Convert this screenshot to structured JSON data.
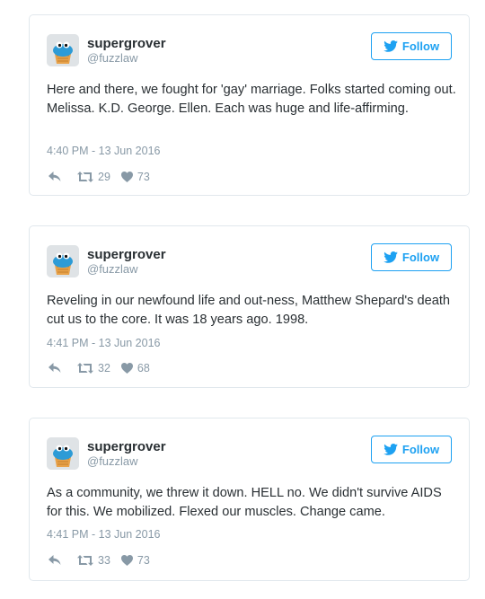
{
  "colors": {
    "accent": "#1da1f2",
    "muted": "#8899a6",
    "text": "#292f33",
    "border": "#e1e8ed"
  },
  "tweets": [
    {
      "name": "supergrover",
      "handle": "@fuzzlaw",
      "follow_label": "Follow",
      "text": "Here and there, we fought for 'gay' marriage. Folks started coming out. Melissa. K.D. George. Ellen. Each was huge and life-affirming.",
      "timestamp": "4:40 PM - 13 Jun 2016",
      "retweets": "29",
      "likes": "73",
      "icons": [
        "avatar",
        "twitter-bird-icon",
        "reply-icon",
        "retweet-icon",
        "heart-icon"
      ]
    },
    {
      "name": "supergrover",
      "handle": "@fuzzlaw",
      "follow_label": "Follow",
      "text": "Reveling in our newfound life and out-ness, Matthew Shepard's death cut us to the core. It was 18 years ago. 1998.",
      "timestamp": "4:41 PM - 13 Jun 2016",
      "retweets": "32",
      "likes": "68",
      "icons": [
        "avatar",
        "twitter-bird-icon",
        "reply-icon",
        "retweet-icon",
        "heart-icon"
      ]
    },
    {
      "name": "supergrover",
      "handle": "@fuzzlaw",
      "follow_label": "Follow",
      "text": "As a community, we threw it down. HELL no. We didn't survive AIDS for this. We mobilized. Flexed our muscles. Change came.",
      "timestamp": "4:41 PM - 13 Jun 2016",
      "retweets": "33",
      "likes": "73",
      "icons": [
        "avatar",
        "twitter-bird-icon",
        "reply-icon",
        "retweet-icon",
        "heart-icon"
      ]
    }
  ]
}
